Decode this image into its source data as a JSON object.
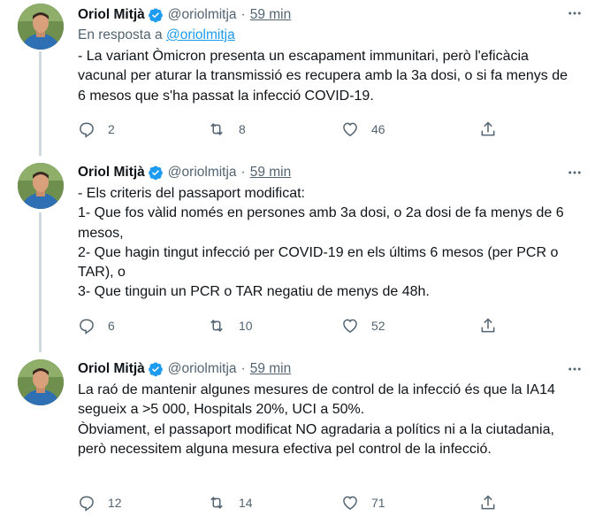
{
  "tweets": [
    {
      "name": "Oriol Mitjà",
      "handle": "@oriolmitja",
      "separator": "·",
      "time": "59 min",
      "reply_prefix": "En resposta a",
      "reply_handle": "@oriolmitja",
      "text": "- La variant Òmicron presenta un escapament immunitari, però l'eficàcia vacunal per aturar la transmissió es recupera amb la 3a dosi, o si fa menys de 6 mesos que s'ha passat la infecció COVID-19.",
      "replies": "2",
      "retweets": "8",
      "likes": "46"
    },
    {
      "name": "Oriol Mitjà",
      "handle": "@oriolmitja",
      "separator": "·",
      "time": "59 min",
      "text": "- Els criteris del passaport modificat:\n1- Que fos vàlid només en persones amb 3a dosi,  o 2a dosi de fa menys de 6 mesos,\n2- Que hagin tingut infecció per COVID-19 en els últims 6 mesos (per PCR o TAR), o\n3- Que tinguin un PCR o TAR negatiu de menys de 48h.",
      "replies": "6",
      "retweets": "10",
      "likes": "52"
    },
    {
      "name": "Oriol Mitjà",
      "handle": "@oriolmitja",
      "separator": "·",
      "time": "59 min",
      "text": "La raó de mantenir algunes mesures de control de la infecció és que la IA14 segueix a >5 000, Hospitals 20%, UCI a 50%.\nÒbviament, el passaport modificat NO agradaria a polítics ni a la ciutadania, però necessitem alguna mesura efectiva pel control de la infecció.",
      "replies": "12",
      "retweets": "14",
      "likes": "71"
    }
  ],
  "colors": {
    "accent": "#1d9bf0",
    "secondary_text": "#536471",
    "thread_line": "#cfd9de"
  },
  "icons": [
    "verified-badge-icon",
    "more-icon",
    "reply-icon",
    "retweet-icon",
    "like-icon",
    "share-icon"
  ]
}
